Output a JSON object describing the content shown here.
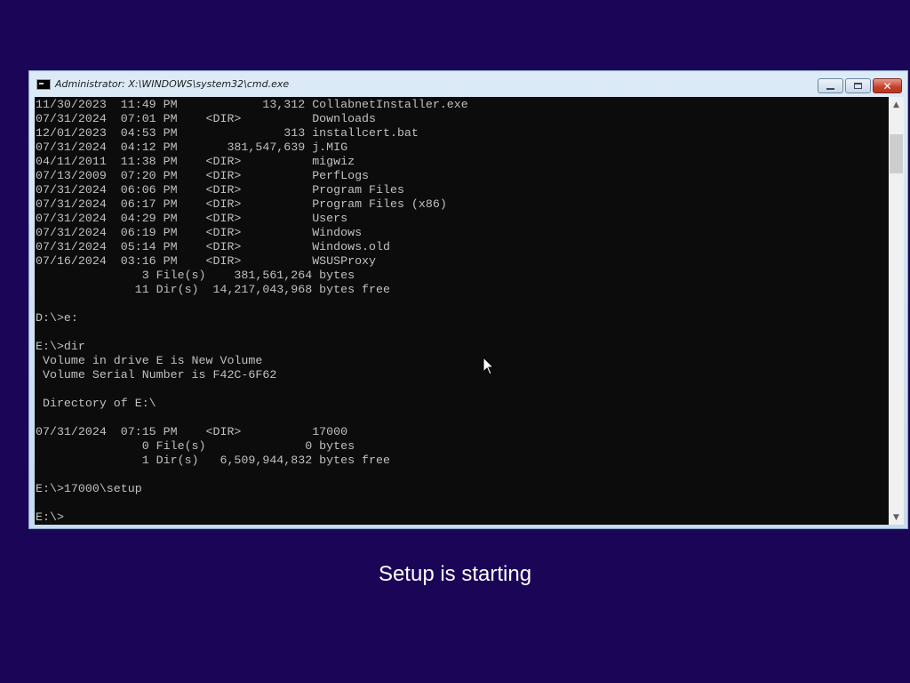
{
  "window": {
    "title": "Administrator: X:\\WINDOWS\\system32\\cmd.exe",
    "controls": {
      "minimize": "minimize-icon",
      "maximize": "maximize-icon",
      "close": "✕"
    }
  },
  "console": {
    "lines": [
      "11/30/2023  11:49 PM            13,312 CollabnetInstaller.exe",
      "07/31/2024  07:01 PM    <DIR>          Downloads",
      "12/01/2023  04:53 PM               313 installcert.bat",
      "07/31/2024  04:12 PM       381,547,639 j.MIG",
      "04/11/2011  11:38 PM    <DIR>          migwiz",
      "07/13/2009  07:20 PM    <DIR>          PerfLogs",
      "07/31/2024  06:06 PM    <DIR>          Program Files",
      "07/31/2024  06:17 PM    <DIR>          Program Files (x86)",
      "07/31/2024  04:29 PM    <DIR>          Users",
      "07/31/2024  06:19 PM    <DIR>          Windows",
      "07/31/2024  05:14 PM    <DIR>          Windows.old",
      "07/16/2024  03:16 PM    <DIR>          WSUSProxy",
      "               3 File(s)    381,561,264 bytes",
      "              11 Dir(s)  14,217,043,968 bytes free",
      "",
      "D:\\>e:",
      "",
      "E:\\>dir",
      " Volume in drive E is New Volume",
      " Volume Serial Number is F42C-6F62",
      "",
      " Directory of E:\\",
      "",
      "07/31/2024  07:15 PM    <DIR>          17000",
      "               0 File(s)              0 bytes",
      "               1 Dir(s)   6,509,944,832 bytes free",
      "",
      "E:\\>17000\\setup",
      "",
      "E:\\>"
    ]
  },
  "scrollbar": {
    "up_arrow": "▲",
    "down_arrow": "▼"
  },
  "status": {
    "message": "Setup is starting"
  },
  "colors": {
    "desktop_background": "#1b0556",
    "console_background": "#0c0c0c",
    "console_text": "#c0c0c0"
  }
}
